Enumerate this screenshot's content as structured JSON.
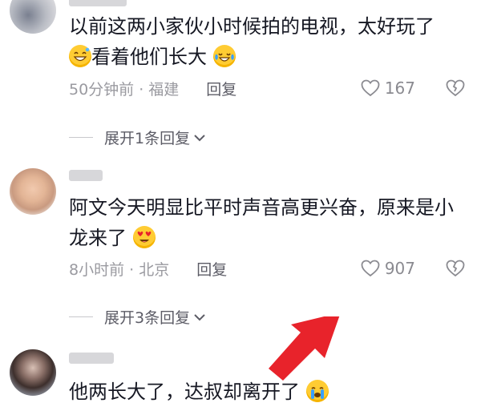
{
  "comments": [
    {
      "text_before": "以前这两小家伙小时候拍的电视，太好玩了",
      "text_after": "看着他们长大",
      "emoji_start": "grinning-sweat-emoji",
      "emoji_end": "tears-of-joy-emoji",
      "time_location": "50分钟前 · 福建",
      "reply_label": "回复",
      "like_count": "167",
      "expand_label": "展开1条回复"
    },
    {
      "text_before": "阿文今天明显比平时声音高更兴奋，原来是小龙来了",
      "emoji_end": "heart-eyes-emoji",
      "time_location": "8小时前 · 北京",
      "reply_label": "回复",
      "like_count": "907",
      "expand_label": "展开3条回复"
    },
    {
      "text_before": "他两长大了，达叔却离开了",
      "emoji_end": "crying-emoji"
    }
  ],
  "colors": {
    "text": "#161823",
    "meta": "#9a9aa0",
    "arrow": "#e8232b"
  }
}
